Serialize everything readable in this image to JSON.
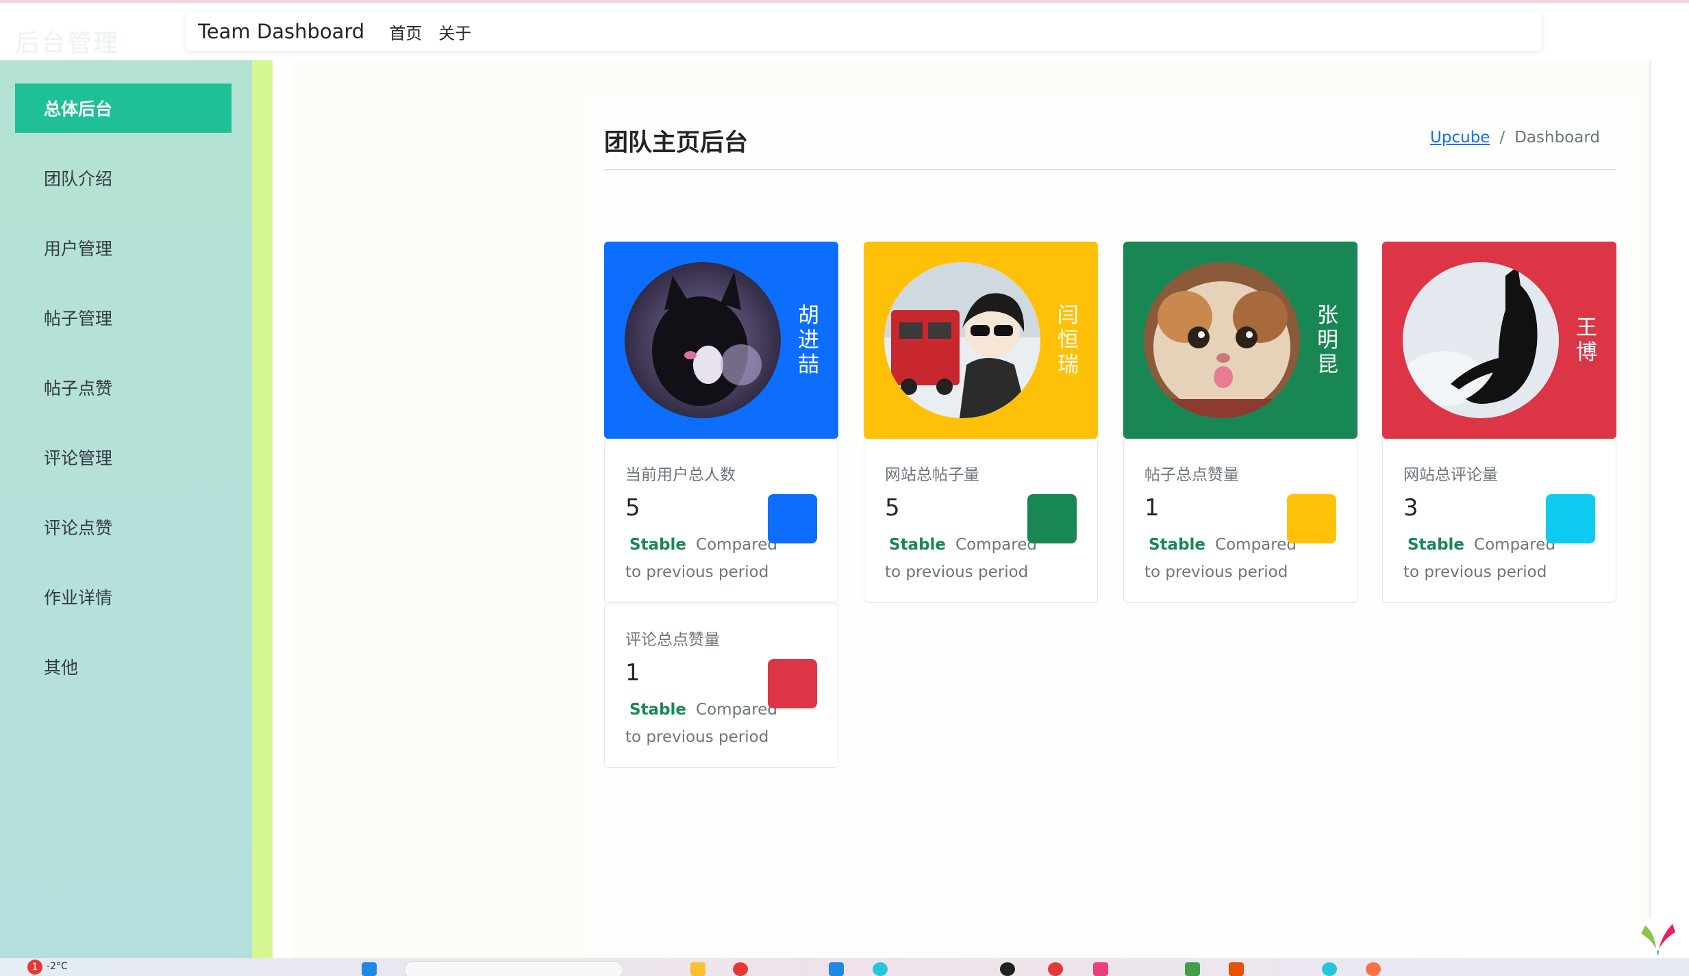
{
  "brand_text": "后台管理",
  "navbar": {
    "brand": "Team Dashboard",
    "links": [
      "首页",
      "关于"
    ]
  },
  "sidebar": {
    "items": [
      {
        "label": "总体后台",
        "active": true
      },
      {
        "label": "团队介绍",
        "active": false
      },
      {
        "label": "用户管理",
        "active": false
      },
      {
        "label": "帖子管理",
        "active": false
      },
      {
        "label": "帖子点赞",
        "active": false
      },
      {
        "label": "评论管理",
        "active": false
      },
      {
        "label": "评论点赞",
        "active": false
      },
      {
        "label": "作业详情",
        "active": false
      },
      {
        "label": "其他",
        "active": false
      }
    ]
  },
  "page": {
    "title": "团队主页后台",
    "breadcrumb": {
      "link": "Upcube",
      "separator": "/",
      "current": "Dashboard"
    }
  },
  "members": [
    {
      "name": [
        "胡",
        "进",
        "喆"
      ],
      "color": "#0d6efd",
      "avatar": "black-cat-icon"
    },
    {
      "name": [
        "闫",
        "恒",
        "瑞"
      ],
      "color": "#ffc107",
      "avatar": "anime-boy-icon"
    },
    {
      "name": [
        "张",
        "明",
        "昆"
      ],
      "color": "#198754",
      "avatar": "cat-face-icon"
    },
    {
      "name": [
        "王",
        "博"
      ],
      "color": "#dc3545",
      "avatar": "black-cat-snow-icon"
    }
  ],
  "stats": [
    {
      "label": "当前用户总人数",
      "value": "5",
      "status": "Stable",
      "compare": "Compared to previous period",
      "color": "#0d6efd"
    },
    {
      "label": "网站总帖子量",
      "value": "5",
      "status": "Stable",
      "compare": "Compared to previous period",
      "color": "#198754"
    },
    {
      "label": "帖子总点赞量",
      "value": "1",
      "status": "Stable",
      "compare": "Compared to previous period",
      "color": "#ffc107"
    },
    {
      "label": "网站总评论量",
      "value": "3",
      "status": "Stable",
      "compare": "Compared to previous period",
      "color": "#0dcaf0"
    },
    {
      "label": "评论总点赞量",
      "value": "1",
      "status": "Stable",
      "compare": "Compared to previous period",
      "color": "#dc3545"
    }
  ],
  "taskbar": {
    "badge": "1",
    "temperature": "-2°C"
  }
}
